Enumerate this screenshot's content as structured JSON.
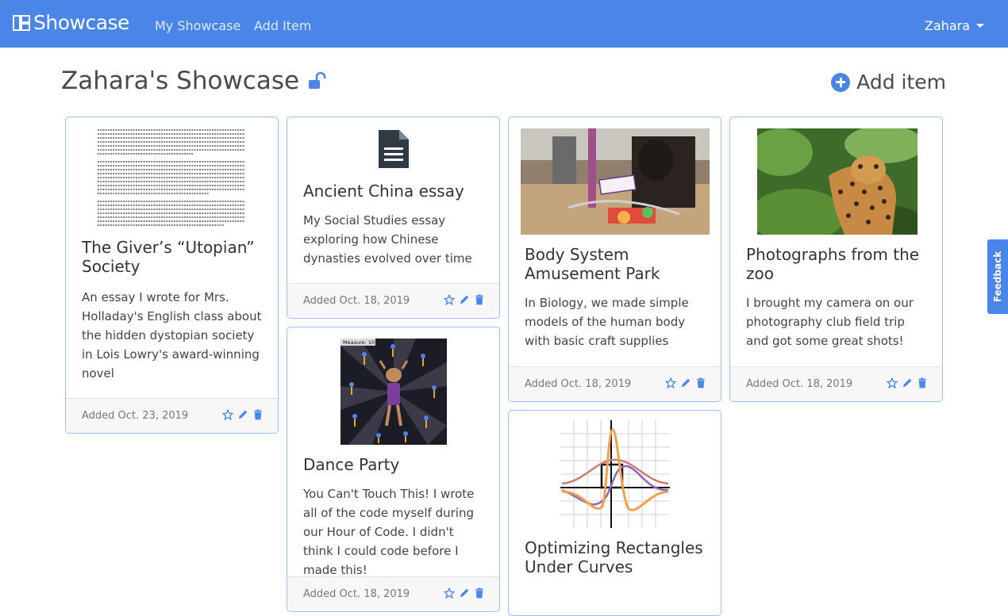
{
  "navbar": {
    "brand": "Showcase",
    "links": [
      "My Showcase",
      "Add Item"
    ],
    "user": "Zahara"
  },
  "header": {
    "title": "Zahara's Showcase",
    "add_item_label": "Add item"
  },
  "feedback_label": "Feedback",
  "cards": [
    {
      "title": "The Giver’s “Utopian” Society",
      "description": "An essay I wrote for Mrs. Holladay's English class about the hidden dystopian society in Lois Lowry's award-winning novel",
      "date": "Added Oct. 23, 2019",
      "thumbnail": "document-text-thumbnail"
    },
    {
      "title": "Ancient China essay",
      "description": "My Social Studies essay exploring how Chinese dynasties evolved over time",
      "date": "Added Oct. 18, 2019",
      "thumbnail": "file-icon"
    },
    {
      "title": "Dance Party",
      "description": "You Can't Touch This! I wrote all of the code myself during our Hour of Code. I didn't think I could code before I made this!",
      "date": "Added Oct. 18, 2019",
      "thumbnail": "dance-party-game-thumbnail",
      "thumbnail_caption": "Measure: 10"
    },
    {
      "title": "Body System Amusement Park",
      "description": "In Biology, we made simple models of the human body with basic craft supplies",
      "date": "Added Oct. 18, 2019",
      "thumbnail": "classroom-craft-photo"
    },
    {
      "title": "Optimizing Rectangles Under Curves",
      "description": "",
      "date": "",
      "thumbnail": "curve-graph-thumbnail"
    },
    {
      "title": "Photographs from the zoo",
      "description": "I brought my camera on our photography club field trip and got some great shots!",
      "date": "Added Oct. 18, 2019",
      "thumbnail": "jaguar-photo"
    }
  ],
  "colors": {
    "primary": "#4a86e8",
    "card_border": "#9ec0ef",
    "footer_bg": "#f7f7f7"
  }
}
